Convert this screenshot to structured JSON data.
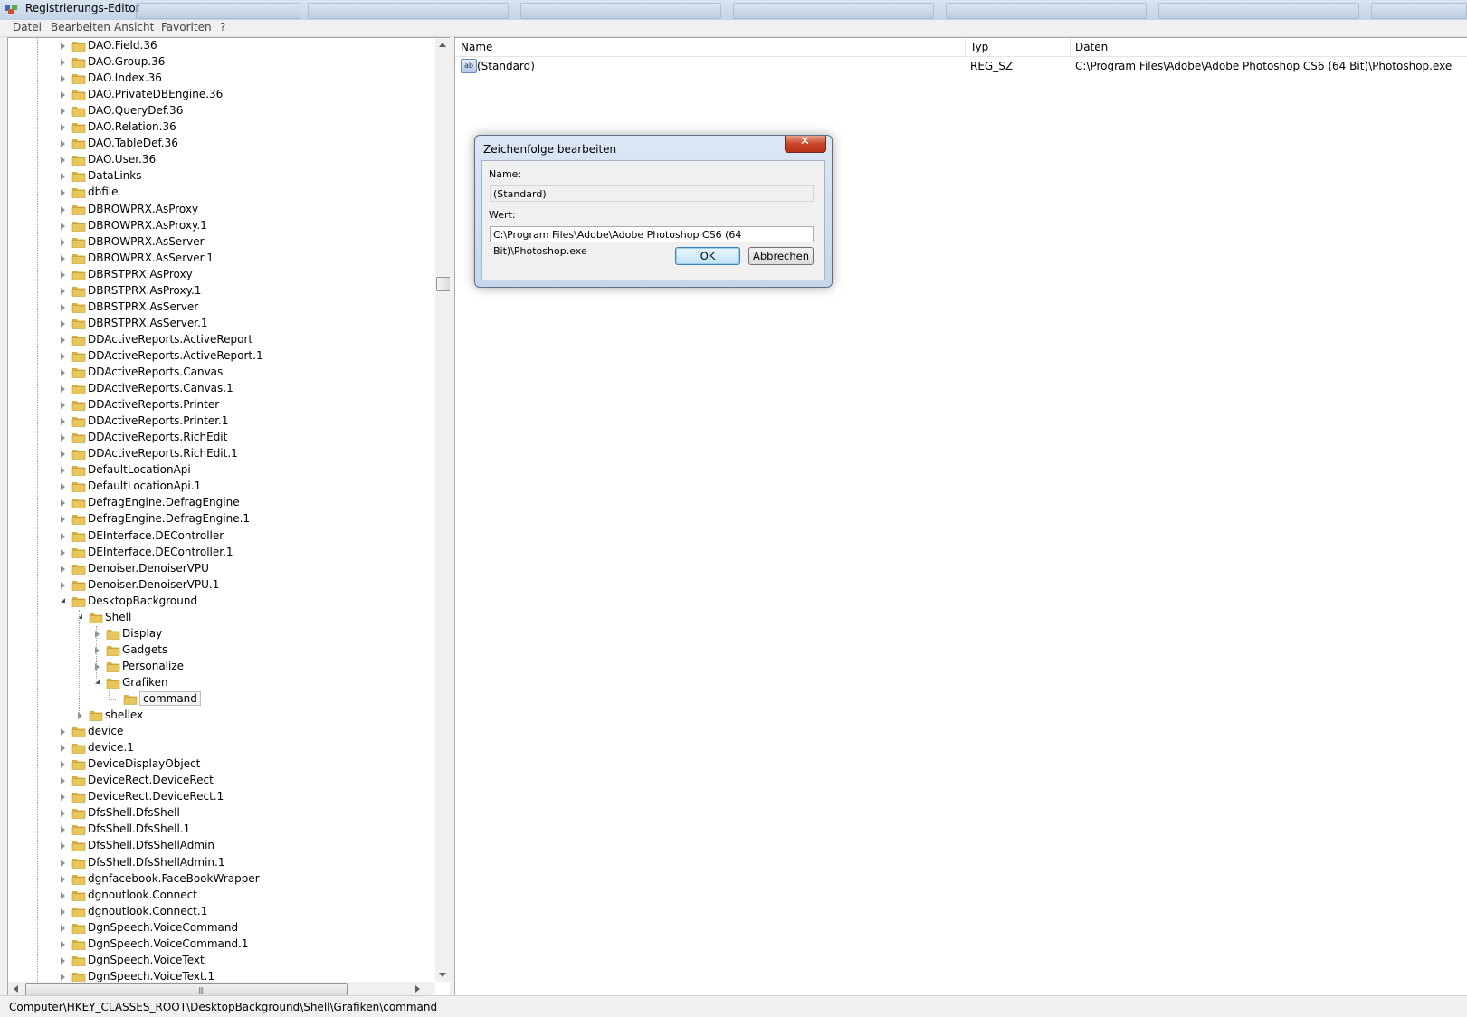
{
  "window": {
    "title": "Registrierungs-Editor"
  },
  "menu": [
    {
      "label": "Datei"
    },
    {
      "label": "Bearbeiten"
    },
    {
      "label": "Ansicht"
    },
    {
      "label": "Favoriten"
    },
    {
      "label": "?"
    }
  ],
  "tree": {
    "items": [
      {
        "label": "DAO.Field.36",
        "depth": 0,
        "state": "collapsed"
      },
      {
        "label": "DAO.Group.36",
        "depth": 0,
        "state": "collapsed"
      },
      {
        "label": "DAO.Index.36",
        "depth": 0,
        "state": "collapsed"
      },
      {
        "label": "DAO.PrivateDBEngine.36",
        "depth": 0,
        "state": "collapsed"
      },
      {
        "label": "DAO.QueryDef.36",
        "depth": 0,
        "state": "collapsed"
      },
      {
        "label": "DAO.Relation.36",
        "depth": 0,
        "state": "collapsed"
      },
      {
        "label": "DAO.TableDef.36",
        "depth": 0,
        "state": "collapsed"
      },
      {
        "label": "DAO.User.36",
        "depth": 0,
        "state": "collapsed"
      },
      {
        "label": "DataLinks",
        "depth": 0,
        "state": "collapsed"
      },
      {
        "label": "dbfile",
        "depth": 0,
        "state": "collapsed"
      },
      {
        "label": "DBROWPRX.AsProxy",
        "depth": 0,
        "state": "collapsed"
      },
      {
        "label": "DBROWPRX.AsProxy.1",
        "depth": 0,
        "state": "collapsed"
      },
      {
        "label": "DBROWPRX.AsServer",
        "depth": 0,
        "state": "collapsed"
      },
      {
        "label": "DBROWPRX.AsServer.1",
        "depth": 0,
        "state": "collapsed"
      },
      {
        "label": "DBRSTPRX.AsProxy",
        "depth": 0,
        "state": "collapsed"
      },
      {
        "label": "DBRSTPRX.AsProxy.1",
        "depth": 0,
        "state": "collapsed"
      },
      {
        "label": "DBRSTPRX.AsServer",
        "depth": 0,
        "state": "collapsed"
      },
      {
        "label": "DBRSTPRX.AsServer.1",
        "depth": 0,
        "state": "collapsed"
      },
      {
        "label": "DDActiveReports.ActiveReport",
        "depth": 0,
        "state": "collapsed"
      },
      {
        "label": "DDActiveReports.ActiveReport.1",
        "depth": 0,
        "state": "collapsed"
      },
      {
        "label": "DDActiveReports.Canvas",
        "depth": 0,
        "state": "collapsed"
      },
      {
        "label": "DDActiveReports.Canvas.1",
        "depth": 0,
        "state": "collapsed"
      },
      {
        "label": "DDActiveReports.Printer",
        "depth": 0,
        "state": "collapsed"
      },
      {
        "label": "DDActiveReports.Printer.1",
        "depth": 0,
        "state": "collapsed"
      },
      {
        "label": "DDActiveReports.RichEdit",
        "depth": 0,
        "state": "collapsed"
      },
      {
        "label": "DDActiveReports.RichEdit.1",
        "depth": 0,
        "state": "collapsed"
      },
      {
        "label": "DefaultLocationApi",
        "depth": 0,
        "state": "collapsed"
      },
      {
        "label": "DefaultLocationApi.1",
        "depth": 0,
        "state": "collapsed"
      },
      {
        "label": "DefragEngine.DefragEngine",
        "depth": 0,
        "state": "collapsed"
      },
      {
        "label": "DefragEngine.DefragEngine.1",
        "depth": 0,
        "state": "collapsed"
      },
      {
        "label": "DEInterface.DEController",
        "depth": 0,
        "state": "collapsed"
      },
      {
        "label": "DEInterface.DEController.1",
        "depth": 0,
        "state": "collapsed"
      },
      {
        "label": "Denoiser.DenoiserVPU",
        "depth": 0,
        "state": "collapsed"
      },
      {
        "label": "Denoiser.DenoiserVPU.1",
        "depth": 0,
        "state": "collapsed"
      },
      {
        "label": "DesktopBackground",
        "depth": 0,
        "state": "expanded"
      },
      {
        "label": "Shell",
        "depth": 1,
        "state": "expanded"
      },
      {
        "label": "Display",
        "depth": 2,
        "state": "collapsed"
      },
      {
        "label": "Gadgets",
        "depth": 2,
        "state": "collapsed"
      },
      {
        "label": "Personalize",
        "depth": 2,
        "state": "collapsed"
      },
      {
        "label": "Grafiken",
        "depth": 2,
        "state": "expanded"
      },
      {
        "label": "command",
        "depth": 3,
        "state": "leaf",
        "selected": true
      },
      {
        "label": "shellex",
        "depth": 1,
        "state": "collapsed"
      },
      {
        "label": "device",
        "depth": 0,
        "state": "collapsed"
      },
      {
        "label": "device.1",
        "depth": 0,
        "state": "collapsed"
      },
      {
        "label": "DeviceDisplayObject",
        "depth": 0,
        "state": "collapsed"
      },
      {
        "label": "DeviceRect.DeviceRect",
        "depth": 0,
        "state": "collapsed"
      },
      {
        "label": "DeviceRect.DeviceRect.1",
        "depth": 0,
        "state": "collapsed"
      },
      {
        "label": "DfsShell.DfsShell",
        "depth": 0,
        "state": "collapsed"
      },
      {
        "label": "DfsShell.DfsShell.1",
        "depth": 0,
        "state": "collapsed"
      },
      {
        "label": "DfsShell.DfsShellAdmin",
        "depth": 0,
        "state": "collapsed"
      },
      {
        "label": "DfsShell.DfsShellAdmin.1",
        "depth": 0,
        "state": "collapsed"
      },
      {
        "label": "dgnfacebook.FaceBookWrapper",
        "depth": 0,
        "state": "collapsed"
      },
      {
        "label": "dgnoutlook.Connect",
        "depth": 0,
        "state": "collapsed"
      },
      {
        "label": "dgnoutlook.Connect.1",
        "depth": 0,
        "state": "collapsed"
      },
      {
        "label": "DgnSpeech.VoiceCommand",
        "depth": 0,
        "state": "collapsed"
      },
      {
        "label": "DgnSpeech.VoiceCommand.1",
        "depth": 0,
        "state": "collapsed"
      },
      {
        "label": "DgnSpeech.VoiceText",
        "depth": 0,
        "state": "collapsed"
      },
      {
        "label": "DgnSpeech.VoiceText.1",
        "depth": 0,
        "state": "collapsed"
      }
    ]
  },
  "list": {
    "columns": {
      "name": "Name",
      "type": "Typ",
      "data": "Daten"
    },
    "rows": [
      {
        "icon": "ab",
        "name": "(Standard)",
        "type": "REG_SZ",
        "data": "C:\\Program Files\\Adobe\\Adobe Photoshop CS6 (64 Bit)\\Photoshop.exe"
      }
    ]
  },
  "dialog": {
    "title": "Zeichenfolge bearbeiten",
    "name_label": "Name:",
    "name_value": "(Standard)",
    "value_label": "Wert:",
    "value_value": "C:\\Program Files\\Adobe\\Adobe Photoshop CS6 (64 Bit)\\Photoshop.exe",
    "ok_label": "OK",
    "cancel_label": "Abbrechen"
  },
  "status": {
    "path": "Computer\\HKEY_CLASSES_ROOT\\DesktopBackground\\Shell\\Grafiken\\command"
  },
  "colors": {
    "folder": "#e8c65a",
    "close_button": "#c8452a",
    "dialog_frame": "#c6d7ec"
  }
}
